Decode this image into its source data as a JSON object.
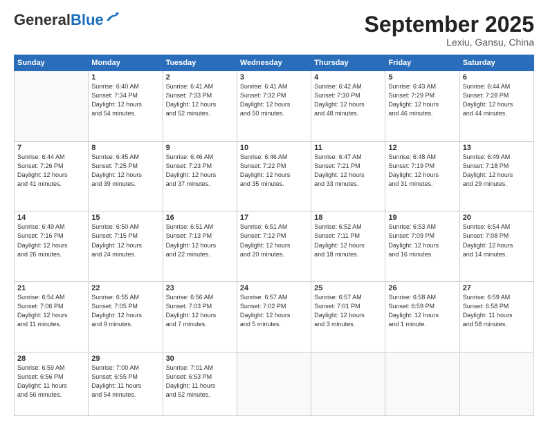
{
  "header": {
    "logo_general": "General",
    "logo_blue": "Blue",
    "month_title": "September 2025",
    "subtitle": "Lexiu, Gansu, China"
  },
  "days_of_week": [
    "Sunday",
    "Monday",
    "Tuesday",
    "Wednesday",
    "Thursday",
    "Friday",
    "Saturday"
  ],
  "weeks": [
    [
      {
        "day": "",
        "info": ""
      },
      {
        "day": "1",
        "info": "Sunrise: 6:40 AM\nSunset: 7:34 PM\nDaylight: 12 hours\nand 54 minutes."
      },
      {
        "day": "2",
        "info": "Sunrise: 6:41 AM\nSunset: 7:33 PM\nDaylight: 12 hours\nand 52 minutes."
      },
      {
        "day": "3",
        "info": "Sunrise: 6:41 AM\nSunset: 7:32 PM\nDaylight: 12 hours\nand 50 minutes."
      },
      {
        "day": "4",
        "info": "Sunrise: 6:42 AM\nSunset: 7:30 PM\nDaylight: 12 hours\nand 48 minutes."
      },
      {
        "day": "5",
        "info": "Sunrise: 6:43 AM\nSunset: 7:29 PM\nDaylight: 12 hours\nand 46 minutes."
      },
      {
        "day": "6",
        "info": "Sunrise: 6:44 AM\nSunset: 7:28 PM\nDaylight: 12 hours\nand 44 minutes."
      }
    ],
    [
      {
        "day": "7",
        "info": "Sunrise: 6:44 AM\nSunset: 7:26 PM\nDaylight: 12 hours\nand 41 minutes."
      },
      {
        "day": "8",
        "info": "Sunrise: 6:45 AM\nSunset: 7:25 PM\nDaylight: 12 hours\nand 39 minutes."
      },
      {
        "day": "9",
        "info": "Sunrise: 6:46 AM\nSunset: 7:23 PM\nDaylight: 12 hours\nand 37 minutes."
      },
      {
        "day": "10",
        "info": "Sunrise: 6:46 AM\nSunset: 7:22 PM\nDaylight: 12 hours\nand 35 minutes."
      },
      {
        "day": "11",
        "info": "Sunrise: 6:47 AM\nSunset: 7:21 PM\nDaylight: 12 hours\nand 33 minutes."
      },
      {
        "day": "12",
        "info": "Sunrise: 6:48 AM\nSunset: 7:19 PM\nDaylight: 12 hours\nand 31 minutes."
      },
      {
        "day": "13",
        "info": "Sunrise: 6:49 AM\nSunset: 7:18 PM\nDaylight: 12 hours\nand 29 minutes."
      }
    ],
    [
      {
        "day": "14",
        "info": "Sunrise: 6:49 AM\nSunset: 7:16 PM\nDaylight: 12 hours\nand 26 minutes."
      },
      {
        "day": "15",
        "info": "Sunrise: 6:50 AM\nSunset: 7:15 PM\nDaylight: 12 hours\nand 24 minutes."
      },
      {
        "day": "16",
        "info": "Sunrise: 6:51 AM\nSunset: 7:13 PM\nDaylight: 12 hours\nand 22 minutes."
      },
      {
        "day": "17",
        "info": "Sunrise: 6:51 AM\nSunset: 7:12 PM\nDaylight: 12 hours\nand 20 minutes."
      },
      {
        "day": "18",
        "info": "Sunrise: 6:52 AM\nSunset: 7:11 PM\nDaylight: 12 hours\nand 18 minutes."
      },
      {
        "day": "19",
        "info": "Sunrise: 6:53 AM\nSunset: 7:09 PM\nDaylight: 12 hours\nand 16 minutes."
      },
      {
        "day": "20",
        "info": "Sunrise: 6:54 AM\nSunset: 7:08 PM\nDaylight: 12 hours\nand 14 minutes."
      }
    ],
    [
      {
        "day": "21",
        "info": "Sunrise: 6:54 AM\nSunset: 7:06 PM\nDaylight: 12 hours\nand 11 minutes."
      },
      {
        "day": "22",
        "info": "Sunrise: 6:55 AM\nSunset: 7:05 PM\nDaylight: 12 hours\nand 9 minutes."
      },
      {
        "day": "23",
        "info": "Sunrise: 6:56 AM\nSunset: 7:03 PM\nDaylight: 12 hours\nand 7 minutes."
      },
      {
        "day": "24",
        "info": "Sunrise: 6:57 AM\nSunset: 7:02 PM\nDaylight: 12 hours\nand 5 minutes."
      },
      {
        "day": "25",
        "info": "Sunrise: 6:57 AM\nSunset: 7:01 PM\nDaylight: 12 hours\nand 3 minutes."
      },
      {
        "day": "26",
        "info": "Sunrise: 6:58 AM\nSunset: 6:59 PM\nDaylight: 12 hours\nand 1 minute."
      },
      {
        "day": "27",
        "info": "Sunrise: 6:59 AM\nSunset: 6:58 PM\nDaylight: 11 hours\nand 58 minutes."
      }
    ],
    [
      {
        "day": "28",
        "info": "Sunrise: 6:59 AM\nSunset: 6:56 PM\nDaylight: 11 hours\nand 56 minutes."
      },
      {
        "day": "29",
        "info": "Sunrise: 7:00 AM\nSunset: 6:55 PM\nDaylight: 11 hours\nand 54 minutes."
      },
      {
        "day": "30",
        "info": "Sunrise: 7:01 AM\nSunset: 6:53 PM\nDaylight: 11 hours\nand 52 minutes."
      },
      {
        "day": "",
        "info": ""
      },
      {
        "day": "",
        "info": ""
      },
      {
        "day": "",
        "info": ""
      },
      {
        "day": "",
        "info": ""
      }
    ]
  ]
}
